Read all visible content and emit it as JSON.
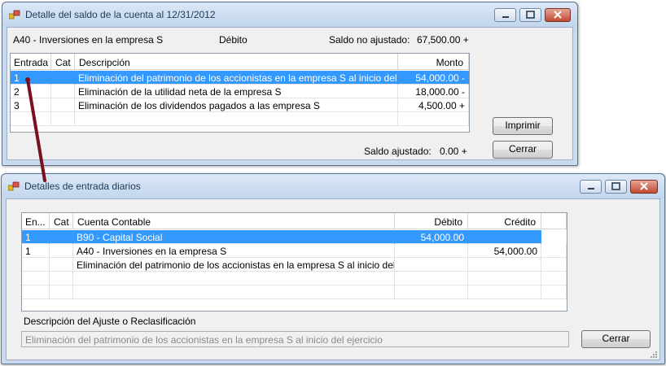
{
  "window1": {
    "title": "Detalle del saldo de la cuenta al 12/31/2012",
    "account": "A40 - Inversiones en la empresa S",
    "balance_type": "Débito",
    "unadjusted_label": "Saldo no ajustado:",
    "unadjusted_value": "67,500.00 +",
    "grid": {
      "headers": {
        "entry": "Entrada",
        "cat": "Cat",
        "description": "Descripción",
        "amount": "Monto"
      },
      "rows": [
        {
          "entry": "1",
          "cat": "",
          "description": "Eliminación del patrimonio de los accionistas en la empresa S al inicio del ejercicio",
          "amount": "54,000.00 -"
        },
        {
          "entry": "2",
          "cat": "",
          "description": "Eliminación de la utilidad neta de la empresa S",
          "amount": "18,000.00 -"
        },
        {
          "entry": "3",
          "cat": "",
          "description": "Eliminación de los dividendos pagados a las empresa S",
          "amount": "4,500.00 +"
        }
      ]
    },
    "print_button": "Imprimir",
    "close_button": "Cerrar",
    "adjusted_label": "Saldo ajustado:",
    "adjusted_value": "0.00 +"
  },
  "window2": {
    "title": "Detalles de entrada diarios",
    "grid": {
      "headers": {
        "entry": "En...",
        "cat": "Cat",
        "account": "Cuenta Contable",
        "debit": "Débito",
        "credit": "Crédito"
      },
      "rows": [
        {
          "entry": "1",
          "cat": "",
          "account": "B90 - Capital Social",
          "debit": "54,000.00",
          "credit": ""
        },
        {
          "entry": "1",
          "cat": "",
          "account": "A40 - Inversiones en la empresa S",
          "debit": "",
          "credit": "54,000.00"
        },
        {
          "entry": "",
          "cat": "",
          "account": "Eliminación del patrimonio de los accionistas en la empresa S al inicio del ejercicio",
          "debit": "",
          "credit": ""
        }
      ]
    },
    "description_label": "Descripción del Ajuste o Reclasificación",
    "description_value": "Eliminación del patrimonio de los accionistas en la empresa S al inicio del ejercicio",
    "close_button": "Cerrar"
  },
  "colors": {
    "selection": "#3399ff",
    "connector": "#7a1020",
    "title_text": "#1e3957"
  }
}
